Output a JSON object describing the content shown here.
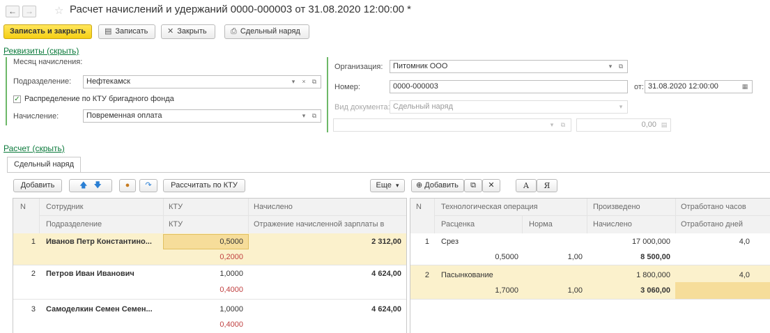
{
  "window": {
    "title": "Расчет начислений и удержаний 0000-000003 от 31.08.2020 12:00:00 *"
  },
  "toolbar": {
    "save_close": "Записать и закрыть",
    "save": "Записать",
    "close": "Закрыть",
    "piecework": "Сдельный наряд"
  },
  "requisites": {
    "link": "Реквизиты (скрыть)",
    "month_label": "Месяц начисления:",
    "division_label": "Подразделение:",
    "division_value": "Нефтекамск",
    "ktu_checkbox": "Распределение по КТУ бригадного фонда",
    "accrual_label": "Начисление:",
    "accrual_value": "Повременная оплата",
    "org_label": "Организация:",
    "org_value": "Питомник ООО",
    "number_label": "Номер:",
    "number_value": "0000-000003",
    "date_label": "от:",
    "date_value": "31.08.2020 12:00:00",
    "doc_type_label": "Вид документа:",
    "doc_type_value": "Сдельный наряд",
    "amount_value": "0,00"
  },
  "calc": {
    "link": "Расчет (скрыть)",
    "tab": "Сдельный наряд"
  },
  "left_table": {
    "buttons": {
      "add": "Добавить",
      "calc_ktu": "Рассчитать по КТУ",
      "more": "Еще"
    },
    "headers": {
      "n": "N",
      "employee": "Сотрудник",
      "division": "Подразделение",
      "ktu": "КТУ",
      "ktu2": "КТУ",
      "accrued": "Начислено",
      "reflection": "Отражение начисленной зарплаты в"
    },
    "rows": [
      {
        "n": "1",
        "employee": "Иванов Петр Константино...",
        "ktu": "0,5000",
        "ktu2": "0,2000",
        "accrued": "2 312,00"
      },
      {
        "n": "2",
        "employee": "Петров Иван Иванович",
        "ktu": "1,0000",
        "ktu2": "0,4000",
        "accrued": "4 624,00"
      },
      {
        "n": "3",
        "employee": "Самоделкин Семен Семен...",
        "ktu": "1,0000",
        "ktu2": "0,4000",
        "accrued": "4 624,00"
      }
    ]
  },
  "right_table": {
    "buttons": {
      "add": "Добавить",
      "font_a": "A",
      "font_ya": "Я"
    },
    "headers": {
      "n": "N",
      "operation": "Технологическая операция",
      "rate": "Расценка",
      "norm": "Норма",
      "produced": "Произведено",
      "accrued": "Начислено",
      "hours": "Отработано часов",
      "days": "Отработано дней"
    },
    "rows": [
      {
        "n": "1",
        "operation": "Срез",
        "rate": "0,5000",
        "norm": "1,00",
        "produced": "17 000,000",
        "accrued": "8 500,00",
        "hours": "4,0"
      },
      {
        "n": "2",
        "operation": "Пасынкование",
        "rate": "1,7000",
        "norm": "1,00",
        "produced": "1 800,000",
        "accrued": "3 060,00",
        "hours": "4,0"
      }
    ]
  }
}
